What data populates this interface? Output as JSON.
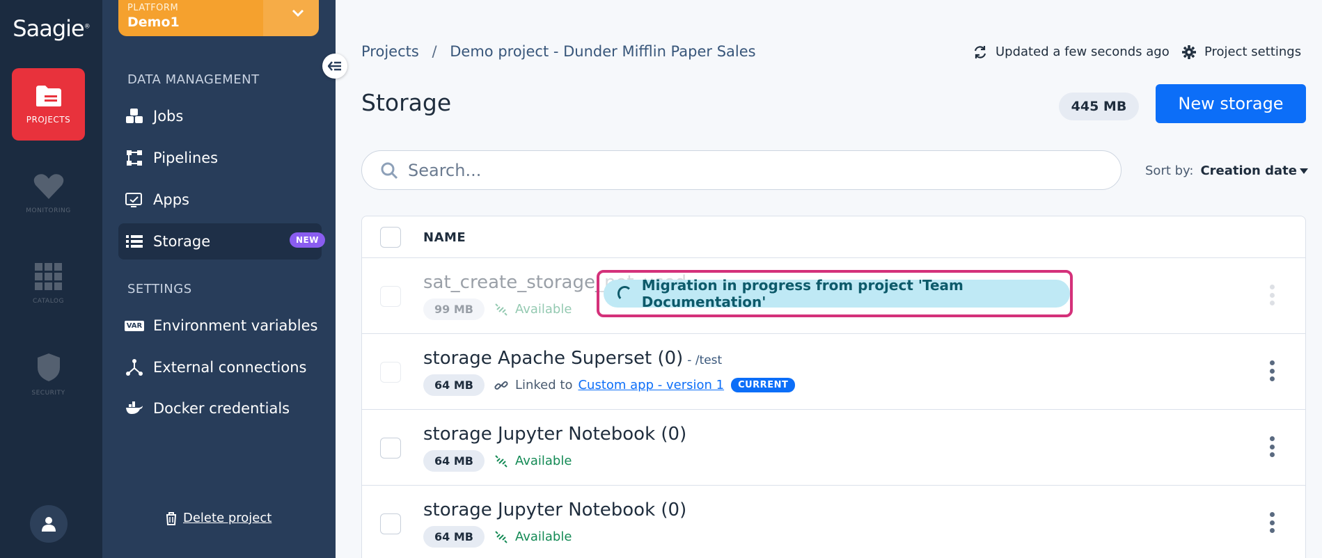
{
  "rail": {
    "logo": "Saagie",
    "items": [
      {
        "label": "PROJECTS"
      },
      {
        "label": "MONITORING"
      },
      {
        "label": "CATALOG"
      },
      {
        "label": "SECURITY"
      }
    ]
  },
  "platform": {
    "label": "PLATFORM",
    "name": "Demo1"
  },
  "sidebar": {
    "data_section": "DATA MANAGEMENT",
    "data_items": [
      {
        "label": "Jobs"
      },
      {
        "label": "Pipelines"
      },
      {
        "label": "Apps"
      },
      {
        "label": "Storage",
        "badge": "NEW"
      }
    ],
    "settings_section": "SETTINGS",
    "settings_items": [
      {
        "label": "Environment variables",
        "icon_text": "VAR"
      },
      {
        "label": "External connections"
      },
      {
        "label": "Docker credentials"
      }
    ],
    "delete_label": "Delete project"
  },
  "header": {
    "breadcrumb_root": "Projects",
    "breadcrumb_sep": "/",
    "breadcrumb_current": "Demo project - Dunder Mifflin Paper Sales",
    "updated": "Updated a few seconds ago",
    "settings": "Project settings"
  },
  "page": {
    "title": "Storage",
    "total_size": "445 MB",
    "new_button": "New storage"
  },
  "search": {
    "placeholder": "Search..."
  },
  "sort": {
    "label": "Sort by:",
    "value": "Creation date"
  },
  "table": {
    "header_name": "NAME",
    "rows": [
      {
        "name": "sat_create_storage_not_used",
        "size": "99 MB",
        "status": "Available"
      },
      {
        "name": "storage Apache Superset (0)",
        "path": "- /test",
        "size": "64 MB",
        "linked_prefix": "Linked to",
        "linked_app": "Custom app - version 1",
        "linked_badge": "CURRENT"
      },
      {
        "name": "storage Jupyter Notebook (0)",
        "size": "64 MB",
        "status": "Available"
      },
      {
        "name": "storage Jupyter Notebook (0)",
        "size": "64 MB",
        "status": "Available"
      }
    ]
  },
  "migration": {
    "text": "Migration in progress from project 'Team Documentation'"
  },
  "colors": {
    "accent": "#0c6ef8",
    "rail": "#1b2b40",
    "sidebar": "#283d5a",
    "active_rail": "#e8323c",
    "platform": "#f5a12e",
    "highlight": "#d4317a"
  }
}
